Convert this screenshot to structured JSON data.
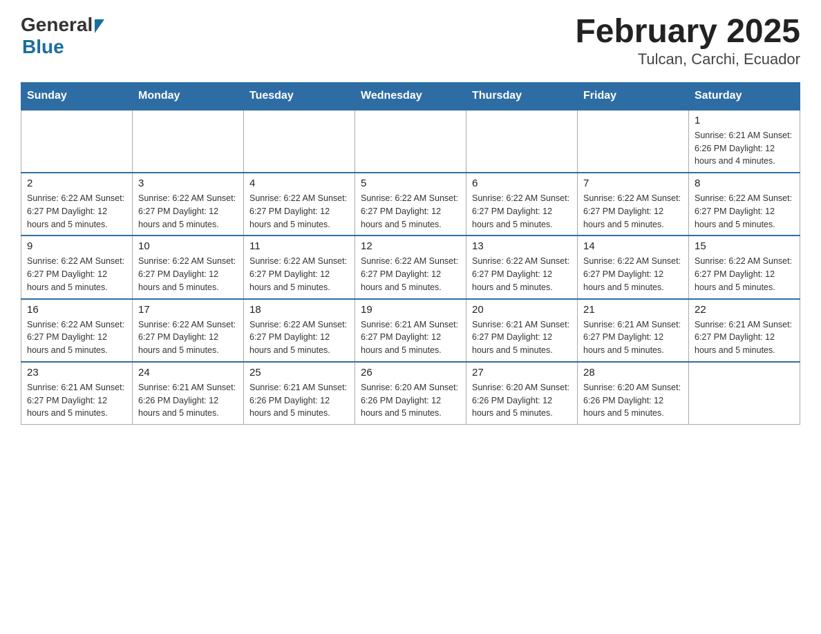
{
  "header": {
    "logo_general": "General",
    "logo_blue": "Blue",
    "title": "February 2025",
    "subtitle": "Tulcan, Carchi, Ecuador"
  },
  "weekdays": [
    "Sunday",
    "Monday",
    "Tuesday",
    "Wednesday",
    "Thursday",
    "Friday",
    "Saturday"
  ],
  "weeks": [
    [
      {
        "day": "",
        "info": ""
      },
      {
        "day": "",
        "info": ""
      },
      {
        "day": "",
        "info": ""
      },
      {
        "day": "",
        "info": ""
      },
      {
        "day": "",
        "info": ""
      },
      {
        "day": "",
        "info": ""
      },
      {
        "day": "1",
        "info": "Sunrise: 6:21 AM\nSunset: 6:26 PM\nDaylight: 12 hours and 4 minutes."
      }
    ],
    [
      {
        "day": "2",
        "info": "Sunrise: 6:22 AM\nSunset: 6:27 PM\nDaylight: 12 hours and 5 minutes."
      },
      {
        "day": "3",
        "info": "Sunrise: 6:22 AM\nSunset: 6:27 PM\nDaylight: 12 hours and 5 minutes."
      },
      {
        "day": "4",
        "info": "Sunrise: 6:22 AM\nSunset: 6:27 PM\nDaylight: 12 hours and 5 minutes."
      },
      {
        "day": "5",
        "info": "Sunrise: 6:22 AM\nSunset: 6:27 PM\nDaylight: 12 hours and 5 minutes."
      },
      {
        "day": "6",
        "info": "Sunrise: 6:22 AM\nSunset: 6:27 PM\nDaylight: 12 hours and 5 minutes."
      },
      {
        "day": "7",
        "info": "Sunrise: 6:22 AM\nSunset: 6:27 PM\nDaylight: 12 hours and 5 minutes."
      },
      {
        "day": "8",
        "info": "Sunrise: 6:22 AM\nSunset: 6:27 PM\nDaylight: 12 hours and 5 minutes."
      }
    ],
    [
      {
        "day": "9",
        "info": "Sunrise: 6:22 AM\nSunset: 6:27 PM\nDaylight: 12 hours and 5 minutes."
      },
      {
        "day": "10",
        "info": "Sunrise: 6:22 AM\nSunset: 6:27 PM\nDaylight: 12 hours and 5 minutes."
      },
      {
        "day": "11",
        "info": "Sunrise: 6:22 AM\nSunset: 6:27 PM\nDaylight: 12 hours and 5 minutes."
      },
      {
        "day": "12",
        "info": "Sunrise: 6:22 AM\nSunset: 6:27 PM\nDaylight: 12 hours and 5 minutes."
      },
      {
        "day": "13",
        "info": "Sunrise: 6:22 AM\nSunset: 6:27 PM\nDaylight: 12 hours and 5 minutes."
      },
      {
        "day": "14",
        "info": "Sunrise: 6:22 AM\nSunset: 6:27 PM\nDaylight: 12 hours and 5 minutes."
      },
      {
        "day": "15",
        "info": "Sunrise: 6:22 AM\nSunset: 6:27 PM\nDaylight: 12 hours and 5 minutes."
      }
    ],
    [
      {
        "day": "16",
        "info": "Sunrise: 6:22 AM\nSunset: 6:27 PM\nDaylight: 12 hours and 5 minutes."
      },
      {
        "day": "17",
        "info": "Sunrise: 6:22 AM\nSunset: 6:27 PM\nDaylight: 12 hours and 5 minutes."
      },
      {
        "day": "18",
        "info": "Sunrise: 6:22 AM\nSunset: 6:27 PM\nDaylight: 12 hours and 5 minutes."
      },
      {
        "day": "19",
        "info": "Sunrise: 6:21 AM\nSunset: 6:27 PM\nDaylight: 12 hours and 5 minutes."
      },
      {
        "day": "20",
        "info": "Sunrise: 6:21 AM\nSunset: 6:27 PM\nDaylight: 12 hours and 5 minutes."
      },
      {
        "day": "21",
        "info": "Sunrise: 6:21 AM\nSunset: 6:27 PM\nDaylight: 12 hours and 5 minutes."
      },
      {
        "day": "22",
        "info": "Sunrise: 6:21 AM\nSunset: 6:27 PM\nDaylight: 12 hours and 5 minutes."
      }
    ],
    [
      {
        "day": "23",
        "info": "Sunrise: 6:21 AM\nSunset: 6:27 PM\nDaylight: 12 hours and 5 minutes."
      },
      {
        "day": "24",
        "info": "Sunrise: 6:21 AM\nSunset: 6:26 PM\nDaylight: 12 hours and 5 minutes."
      },
      {
        "day": "25",
        "info": "Sunrise: 6:21 AM\nSunset: 6:26 PM\nDaylight: 12 hours and 5 minutes."
      },
      {
        "day": "26",
        "info": "Sunrise: 6:20 AM\nSunset: 6:26 PM\nDaylight: 12 hours and 5 minutes."
      },
      {
        "day": "27",
        "info": "Sunrise: 6:20 AM\nSunset: 6:26 PM\nDaylight: 12 hours and 5 minutes."
      },
      {
        "day": "28",
        "info": "Sunrise: 6:20 AM\nSunset: 6:26 PM\nDaylight: 12 hours and 5 minutes."
      },
      {
        "day": "",
        "info": ""
      }
    ]
  ]
}
